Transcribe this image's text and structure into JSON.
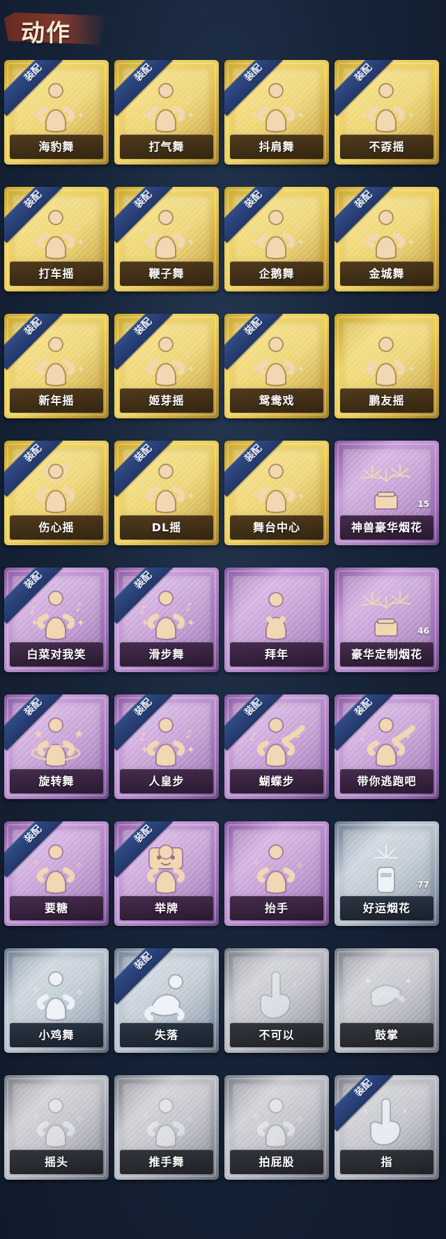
{
  "header": {
    "title": "动作"
  },
  "badge_text": "装配",
  "items": [
    {
      "label": "海豹舞",
      "equipped": true,
      "tier": "gold",
      "count": "",
      "icon": "seal-dance-icon"
    },
    {
      "label": "打气舞",
      "equipped": true,
      "tier": "gold",
      "count": "",
      "icon": "cheer-dance-icon"
    },
    {
      "label": "抖肩舞",
      "equipped": true,
      "tier": "gold",
      "count": "",
      "icon": "shoulder-shake-icon"
    },
    {
      "label": "不孬摇",
      "equipped": true,
      "tier": "gold",
      "count": "",
      "icon": "dance-icon"
    },
    {
      "label": "打车摇",
      "equipped": true,
      "tier": "gold",
      "count": "",
      "icon": "dance-icon"
    },
    {
      "label": "鞭子舞",
      "equipped": true,
      "tier": "gold",
      "count": "",
      "icon": "whip-dance-icon"
    },
    {
      "label": "企鹅舞",
      "equipped": true,
      "tier": "gold",
      "count": "",
      "icon": "penguin-dance-icon"
    },
    {
      "label": "金城舞",
      "equipped": true,
      "tier": "gold",
      "count": "",
      "icon": "dance-icon"
    },
    {
      "label": "新年摇",
      "equipped": true,
      "tier": "gold",
      "count": "",
      "icon": "new-year-dance-icon"
    },
    {
      "label": "姬芽摇",
      "equipped": true,
      "tier": "gold",
      "count": "",
      "icon": "dance-icon"
    },
    {
      "label": "鸳鸯戏",
      "equipped": true,
      "tier": "gold",
      "count": "",
      "icon": "dance-icon"
    },
    {
      "label": "鹏友摇",
      "equipped": false,
      "tier": "gold",
      "count": "",
      "icon": "dance-icon"
    },
    {
      "label": "伤心摇",
      "equipped": true,
      "tier": "gold",
      "count": "",
      "icon": "heart-hands-icon"
    },
    {
      "label": "DL摇",
      "equipped": true,
      "tier": "gold",
      "count": "",
      "icon": "dance-icon"
    },
    {
      "label": "舞台中心",
      "equipped": true,
      "tier": "gold",
      "count": "",
      "icon": "spotlight-dance-icon"
    },
    {
      "label": "神兽豪华烟花",
      "equipped": false,
      "tier": "purple",
      "count": "15",
      "icon": "fireworks-icon"
    },
    {
      "label": "白菜对我笑",
      "equipped": true,
      "tier": "purple",
      "count": "",
      "icon": "dance-icon"
    },
    {
      "label": "滑步舞",
      "equipped": true,
      "tier": "purple",
      "count": "",
      "icon": "dance-icon"
    },
    {
      "label": "拜年",
      "equipped": false,
      "tier": "purple",
      "count": "",
      "icon": "bow-icon"
    },
    {
      "label": "豪华定制烟花",
      "equipped": false,
      "tier": "purple",
      "count": "46",
      "icon": "fireworks-icon"
    },
    {
      "label": "旋转舞",
      "equipped": true,
      "tier": "purple",
      "count": "",
      "icon": "spin-dance-icon"
    },
    {
      "label": "人皇步",
      "equipped": true,
      "tier": "purple",
      "count": "",
      "icon": "dance-icon"
    },
    {
      "label": "蝴蝶步",
      "equipped": true,
      "tier": "purple",
      "count": "",
      "icon": "butterfly-step-icon"
    },
    {
      "label": "带你逃跑吧",
      "equipped": true,
      "tier": "purple",
      "count": "",
      "icon": "point-dance-icon"
    },
    {
      "label": "要糖",
      "equipped": true,
      "tier": "purple",
      "count": "",
      "icon": "ask-candy-icon"
    },
    {
      "label": "举牌",
      "equipped": true,
      "tier": "purple",
      "count": "",
      "icon": "sign-hold-icon"
    },
    {
      "label": "抬手",
      "equipped": false,
      "tier": "purple",
      "count": "",
      "icon": "raise-hand-icon"
    },
    {
      "label": "好运烟花",
      "equipped": false,
      "tier": "silver",
      "count": "77",
      "icon": "firecracker-icon"
    },
    {
      "label": "小鸡舞",
      "equipped": false,
      "tier": "silver",
      "count": "",
      "icon": "chicken-dance-icon"
    },
    {
      "label": "失落",
      "equipped": true,
      "tier": "silver",
      "count": "",
      "icon": "kneel-icon"
    },
    {
      "label": "不可以",
      "equipped": false,
      "tier": "gray",
      "count": "",
      "icon": "finger-wag-icon"
    },
    {
      "label": "鼓掌",
      "equipped": false,
      "tier": "gray",
      "count": "",
      "icon": "clap-icon"
    },
    {
      "label": "摇头",
      "equipped": false,
      "tier": "gray",
      "count": "",
      "icon": "shake-head-icon"
    },
    {
      "label": "推手舞",
      "equipped": false,
      "tier": "gray",
      "count": "",
      "icon": "push-hands-icon"
    },
    {
      "label": "拍屁股",
      "equipped": false,
      "tier": "gray",
      "count": "",
      "icon": "butt-slap-icon"
    },
    {
      "label": "指",
      "equipped": true,
      "tier": "gray",
      "count": "",
      "icon": "point-icon"
    }
  ],
  "colors": {
    "background": "#17253a",
    "badge": "#23386b",
    "tier_gold": "#e9cc5a",
    "tier_purple": "#b58bc9",
    "tier_silver": "#b3bec9",
    "tier_gray": "#b5b7bf"
  }
}
